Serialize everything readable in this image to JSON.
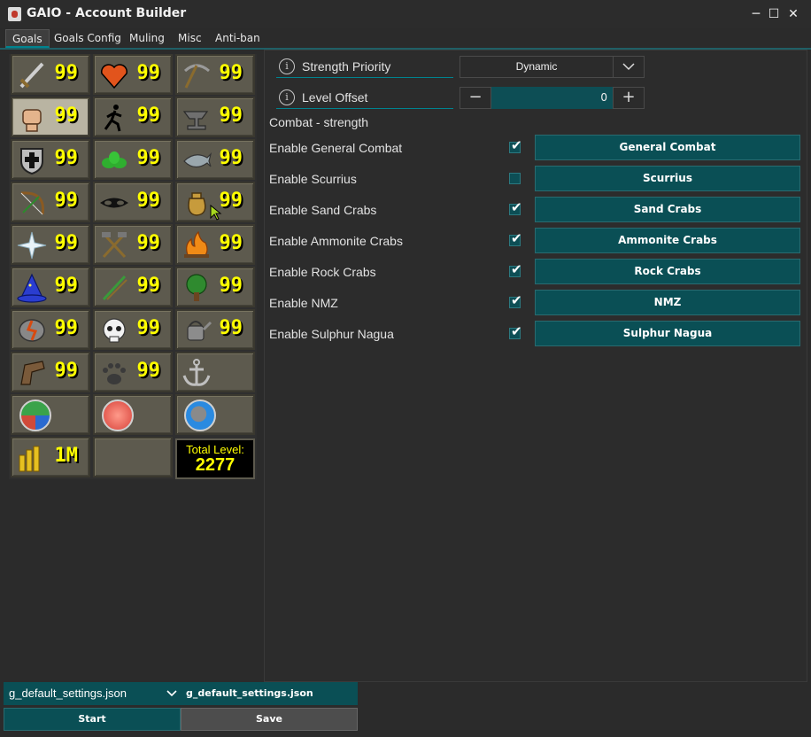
{
  "window": {
    "title": "GAIO - Account Builder"
  },
  "menu": [
    "Goals",
    "Goals Config",
    "Muling",
    "Misc",
    "Anti-ban"
  ],
  "skills": {
    "rows": [
      [
        {
          "icon": "sword-icon",
          "level": "99"
        },
        {
          "icon": "heart-icon",
          "level": "99"
        },
        {
          "icon": "pickaxe-icon",
          "level": "99"
        }
      ],
      [
        {
          "icon": "fist-icon",
          "level": "99",
          "selected": true
        },
        {
          "icon": "running-man-icon",
          "level": "99"
        },
        {
          "icon": "anvil-icon",
          "level": "99"
        }
      ],
      [
        {
          "icon": "shield-icon",
          "level": "99"
        },
        {
          "icon": "herb-icon",
          "level": "99"
        },
        {
          "icon": "fishing-icon",
          "level": "99"
        }
      ],
      [
        {
          "icon": "bow-icon",
          "level": "99"
        },
        {
          "icon": "mask-icon",
          "level": "99"
        },
        {
          "icon": "sack-icon",
          "level": "99"
        }
      ],
      [
        {
          "icon": "star-icon",
          "level": "99"
        },
        {
          "icon": "crossed-hammer-icon",
          "level": "99"
        },
        {
          "icon": "fire-icon",
          "level": "99"
        }
      ],
      [
        {
          "icon": "wizard-hat-icon",
          "level": "99"
        },
        {
          "icon": "fletching-arrow-icon",
          "level": "99"
        },
        {
          "icon": "tree-icon",
          "level": "99"
        }
      ],
      [
        {
          "icon": "rune-icon",
          "level": "99"
        },
        {
          "icon": "skull-icon",
          "level": "99"
        },
        {
          "icon": "watering-can-icon",
          "level": "99"
        }
      ],
      [
        {
          "icon": "boot-icon",
          "level": "99"
        },
        {
          "icon": "paw-icon",
          "level": "99"
        },
        {
          "icon": "anchor-icon",
          "level": ""
        }
      ]
    ],
    "orbs": [
      "teleport-orb-icon",
      "red-orb-icon",
      "blue-orb-icon"
    ],
    "gold": "1M",
    "total_label": "Total Level:",
    "total_value": "2277"
  },
  "settings": {
    "priority_label": "Strength Priority",
    "priority_value": "Dynamic",
    "offset_label": "Level Offset",
    "offset_value": "0",
    "section_title": "Combat - strength",
    "rows": [
      {
        "label": "Enable General Combat",
        "checked": true,
        "button": "General Combat"
      },
      {
        "label": "Enable Scurrius",
        "checked": false,
        "button": "Scurrius"
      },
      {
        "label": "Enable Sand Crabs",
        "checked": true,
        "button": "Sand Crabs"
      },
      {
        "label": "Enable Ammonite Crabs",
        "checked": true,
        "button": "Ammonite Crabs"
      },
      {
        "label": "Enable Rock Crabs",
        "checked": true,
        "button": "Rock Crabs"
      },
      {
        "label": "Enable NMZ",
        "checked": true,
        "button": "NMZ"
      },
      {
        "label": "Enable Sulphur Nagua",
        "checked": true,
        "button": "Sulphur Nagua"
      }
    ]
  },
  "bottom": {
    "config_select": "g_default_settings.json",
    "config_name": "g_default_settings.json",
    "start": "Start",
    "save": "Save"
  },
  "colors": {
    "accent": "#0a4f55",
    "level": "#ffff00",
    "cell": "#5d5a4e"
  }
}
